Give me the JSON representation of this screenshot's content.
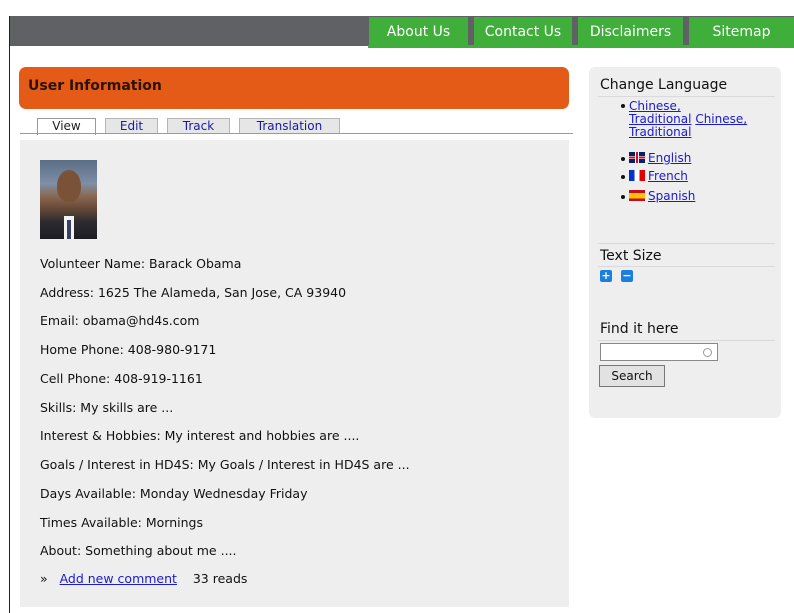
{
  "nav": {
    "items": [
      "About Us",
      "Contact Us",
      "Disclaimers",
      "Sitemap"
    ]
  },
  "page": {
    "title": "User Information",
    "tabs": [
      "View",
      "Edit",
      "Track",
      "Translation"
    ],
    "active_tab": "View"
  },
  "profile": {
    "fields": [
      "Volunteer Name: Barack Obama",
      "Address: 1625 The Alameda, San Jose, CA 93940",
      "Email: obama@hd4s.com",
      "Home Phone: 408-980-9171",
      "Cell Phone: 408-919-1161",
      "Skills: My skills are ...",
      "Interest & Hobbies: My interest and hobbies are ....",
      "Goals / Interest in HD4S: My Goals / Interest in HD4S are ...",
      "Days Available: Monday Wednesday Friday",
      "Times Available: Mornings",
      "About: Something about me ...."
    ],
    "footer": {
      "prefix": "»",
      "comment_link": "Add new comment",
      "reads": "33 reads"
    }
  },
  "sidebar": {
    "change_language": {
      "title": "Change Language",
      "chinese_1_line1": "Chinese,",
      "chinese_1_line2": "Traditional",
      "chinese_2_line1": "Chinese,",
      "chinese_2_line2": "Traditional",
      "english": "English",
      "french": "French",
      "spanish": "Spanish"
    },
    "text_size": {
      "title": "Text Size",
      "increase": "+",
      "decrease": "−"
    },
    "find": {
      "title": "Find it here",
      "search_value": "",
      "search_button": "Search"
    }
  },
  "colors": {
    "nav_green": "#3fae3a",
    "topbar_gray": "#5f6165",
    "header_orange": "#e45a17",
    "link_blue": "#1a1ad0"
  }
}
